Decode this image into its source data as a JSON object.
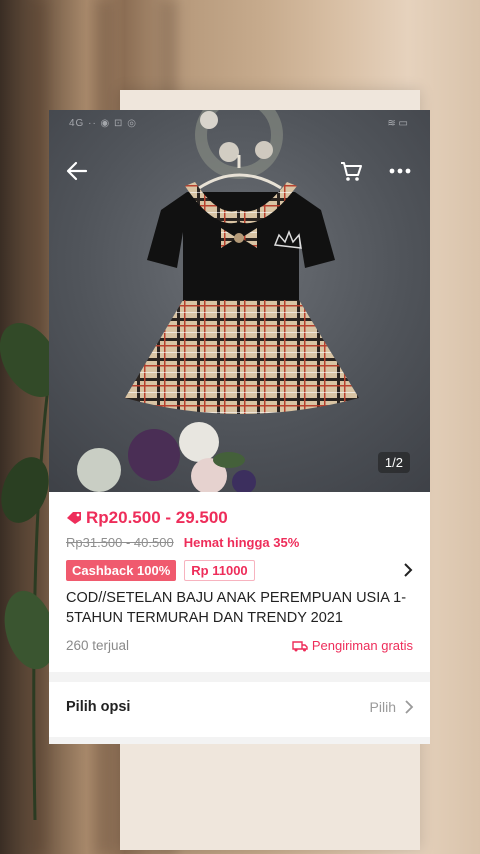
{
  "status_bar": {
    "left": "4G ·· ◉ ⊡ ◎",
    "right": "≋ ▭"
  },
  "header": {
    "back_icon": "arrow-left-icon",
    "cart_icon": "cart-icon",
    "more_icon": "more-dots-icon"
  },
  "image": {
    "counter": "1/2"
  },
  "product": {
    "price_range": "Rp20.500 - 29.500",
    "old_price_range": "Rp31.500 - 40.500",
    "savings": "Hemat hingga 35%",
    "cashback_badge": "Cashback 100%",
    "coin_badge": "Rp 11000",
    "title": "COD//SETELAN BAJU ANAK PEREMPUAN USIA 1-5TAHUN TERMURAH DAN TRENDY 2021",
    "sold": "260 terjual",
    "shipping": "Pengiriman gratis"
  },
  "options": {
    "label": "Pilih opsi",
    "action": "Pilih"
  },
  "colors": {
    "accent": "#ee2d5a",
    "badge": "#f05a6e"
  }
}
